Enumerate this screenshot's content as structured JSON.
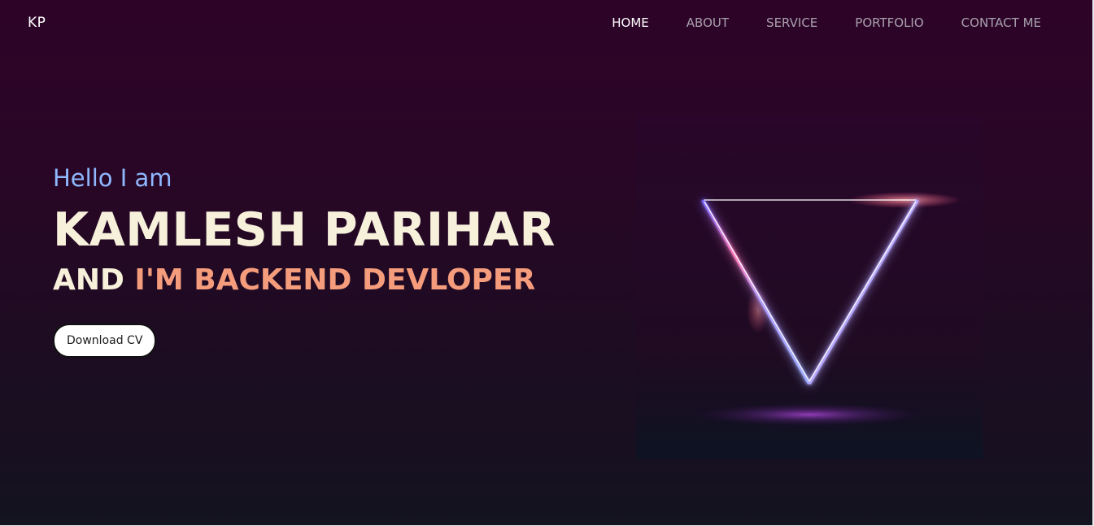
{
  "header": {
    "logo": "KP",
    "nav": [
      {
        "label": "HOME",
        "active": true
      },
      {
        "label": "ABOUT",
        "active": false
      },
      {
        "label": "SERVICE",
        "active": false
      },
      {
        "label": "PORTFOLIO",
        "active": false
      },
      {
        "label": "CONTACT ME",
        "active": false
      }
    ]
  },
  "hero": {
    "greeting": "Hello I am",
    "name": "KAMLESH PARIHAR",
    "role_prefix": "AND",
    "role_title": "I'M BACKEND DEVLOPER",
    "cta_label": "Download CV"
  },
  "colors": {
    "greeting": "#8fb8ff",
    "name": "#f7f1dc",
    "role_accent": "#f59c7c",
    "background_top": "#2d0428",
    "background_bottom": "#141320"
  },
  "graphic": {
    "icon": "neon-triangle"
  }
}
